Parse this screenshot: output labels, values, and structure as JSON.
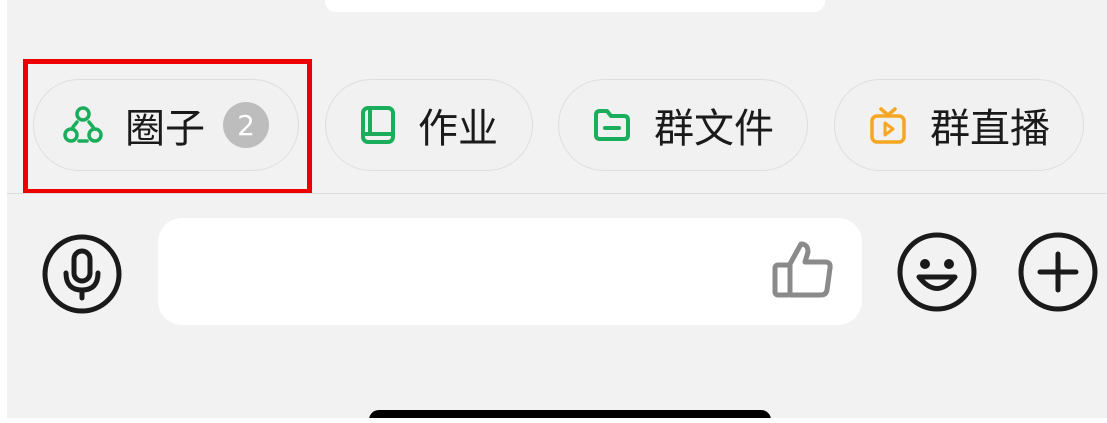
{
  "toolbar": {
    "chips": [
      {
        "label": "圈子",
        "icon": "circle-group-icon",
        "badge": "2",
        "color": "#1aad5b"
      },
      {
        "label": "作业",
        "icon": "homework-book-icon",
        "color": "#1aad5b"
      },
      {
        "label": "群文件",
        "icon": "folder-icon",
        "color": "#1aad5b"
      },
      {
        "label": "群直播",
        "icon": "tv-live-icon",
        "color": "#f5a623"
      }
    ]
  },
  "input_bar": {
    "voice_icon": "microphone-icon",
    "input_value": "",
    "like_icon": "thumbs-up-icon",
    "emoji_icon": "smiley-face-icon",
    "add_icon": "plus-icon"
  },
  "colors": {
    "highlight": "#ee0000",
    "background": "#f2f2f2",
    "badge": "#bdbdbd"
  }
}
